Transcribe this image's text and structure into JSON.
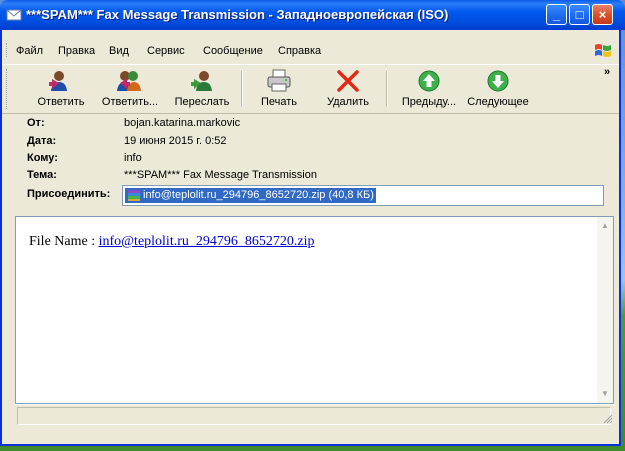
{
  "window": {
    "title": "***SPAM*** Fax Message Transmission - Западноевропейская (ISO)"
  },
  "titlebar_buttons": {
    "minimize": "_",
    "maximize": "□",
    "close": "×"
  },
  "menu": [
    "Файл",
    "Правка",
    "Вид",
    "Сервис",
    "Сообщение",
    "Справка"
  ],
  "toolbar": {
    "reply": "Ответить",
    "reply_all": "Ответить...",
    "forward": "Переслать",
    "print": "Печать",
    "delete": "Удалить",
    "previous": "Предыду...",
    "next": "Следующее",
    "overflow": "»"
  },
  "header": {
    "from_label": "От:",
    "from_value": "bojan.katarina.markovic",
    "date_label": "Дата:",
    "date_value": "19 июня 2015 г. 0:52",
    "to_label": "Кому:",
    "to_value": "info",
    "subject_label": "Тема:",
    "subject_value": "***SPAM*** Fax Message Transmission",
    "attach_label": "Присоединить:",
    "attach_value": "info@teplolit.ru_294796_8652720.zip (40,8 КБ)"
  },
  "body": {
    "prefix": "File Name : ",
    "link": "info@teplolit.ru_294796_8652720.zip"
  },
  "colors": {
    "title_blue": "#0058ee",
    "selection": "#316ac5",
    "link": "#0000cc"
  }
}
